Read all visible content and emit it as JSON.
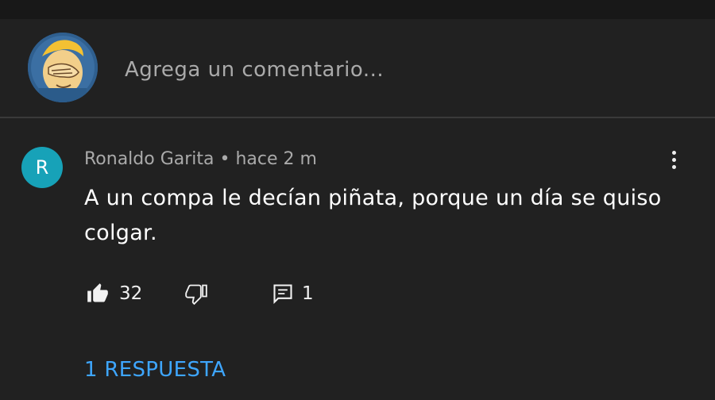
{
  "composer": {
    "placeholder": "Agrega un comentario..."
  },
  "comment": {
    "avatar_letter": "R",
    "meta": "Ronaldo Garita • hace 2 m",
    "text": "A un compa le decían piñata, porque un día se quiso colgar.",
    "likes": "32",
    "replies_count": "1",
    "replies_label": "1 RESPUESTA",
    "avatar_color": "#17a2b8"
  },
  "colors": {
    "background": "#212121",
    "link": "#3ea6ff",
    "secondary_text": "#aaaaaa"
  },
  "icons": [
    "user-avatar-facepalm-icon",
    "more-vert-icon",
    "thumbs-up-icon",
    "thumbs-down-icon",
    "reply-icon"
  ]
}
